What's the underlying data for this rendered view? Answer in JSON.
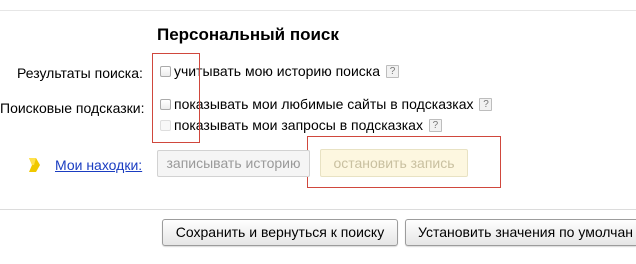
{
  "section_title": "Персональный поиск",
  "search_results": {
    "label": "Результаты поиска:",
    "option": "учитывать мою историю поиска",
    "help": "?"
  },
  "search_suggestions": {
    "label": "Поисковые подсказки:",
    "options": [
      {
        "text": "показывать мои любимые сайты в подсказках",
        "help": "?"
      },
      {
        "text": "показывать мои запросы в подсказках",
        "help": "?"
      }
    ]
  },
  "my_finds": {
    "link": "Мои находки:",
    "record_button": "записывать историю",
    "stop_button": "остановить запись"
  },
  "footer": {
    "save_button": "Сохранить и вернуться к поиску",
    "defaults_button": "Установить значения по умолчан"
  },
  "colors": {
    "link": "#1a3dc1",
    "highlight_box": "#d0473d",
    "stop_button_bg": "#fdf7e0",
    "icon": "#f0c800"
  }
}
